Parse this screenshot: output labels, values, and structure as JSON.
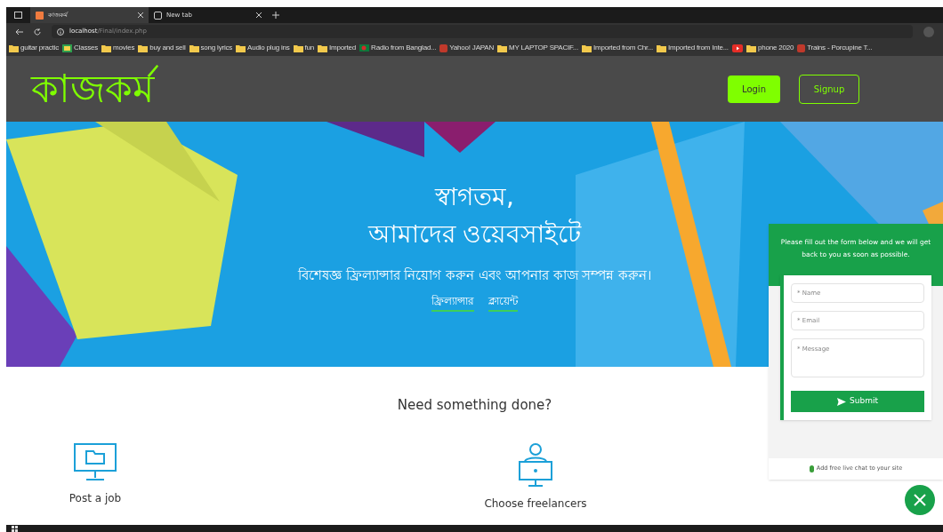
{
  "browser": {
    "tabs": [
      {
        "title": "কাজকর্ম",
        "selected": true
      },
      {
        "title": "New tab",
        "selected": false
      }
    ],
    "address": {
      "host": "localhost",
      "path": "/Final/index.php"
    },
    "bookmarks": [
      {
        "label": "guitar practic",
        "kind": "folder"
      },
      {
        "label": "Classes",
        "kind": "classroom"
      },
      {
        "label": "movies",
        "kind": "folder"
      },
      {
        "label": "buy and sell",
        "kind": "folder"
      },
      {
        "label": "song lyrics",
        "kind": "folder"
      },
      {
        "label": "Audio plug ins",
        "kind": "folder"
      },
      {
        "label": "fun",
        "kind": "folder"
      },
      {
        "label": "Imported",
        "kind": "folder"
      },
      {
        "label": "Radio from Banglad...",
        "kind": "flag"
      },
      {
        "label": "Yahoo! JAPAN",
        "kind": "site"
      },
      {
        "label": "MY LAPTOP SPACIF...",
        "kind": "folder"
      },
      {
        "label": "Imported from Chr...",
        "kind": "folder"
      },
      {
        "label": "Imported from Inte...",
        "kind": "folder"
      },
      {
        "kind": "video"
      },
      {
        "label": "phone 2020",
        "kind": "folder"
      },
      {
        "label": "Trains - Porcupine T...",
        "kind": "site"
      }
    ]
  },
  "site": {
    "logo": "কাজকর্ম",
    "login": "Login",
    "signup": "Signup",
    "hero": {
      "title_lines": [
        "স্বাগতম,",
        "আমাদের ওয়েবসাইটে"
      ],
      "subtitle": "বিশেষজ্ঞ ফ্রিল্যান্সার নিয়োগ করুন এবং আপনার কাজ সম্পন্ন করুন।",
      "links": [
        "ফ্রিল্যান্সার",
        "ক্লায়েন্ট"
      ]
    },
    "section_title": "Need something done?",
    "features": [
      {
        "kind": "monitor",
        "label": "Post a job"
      },
      {
        "kind": "person",
        "label": "Choose freelancers"
      }
    ]
  },
  "chat_widget": {
    "intro": "Please fill out the form below and we will get back to you as soon as possible.",
    "fields": [
      {
        "placeholder": "* Name",
        "kind": "input"
      },
      {
        "placeholder": "* Email",
        "kind": "input"
      },
      {
        "placeholder": "* Message",
        "kind": "textarea"
      }
    ],
    "submit": "Submit",
    "footer": "Add free live chat to your site"
  }
}
